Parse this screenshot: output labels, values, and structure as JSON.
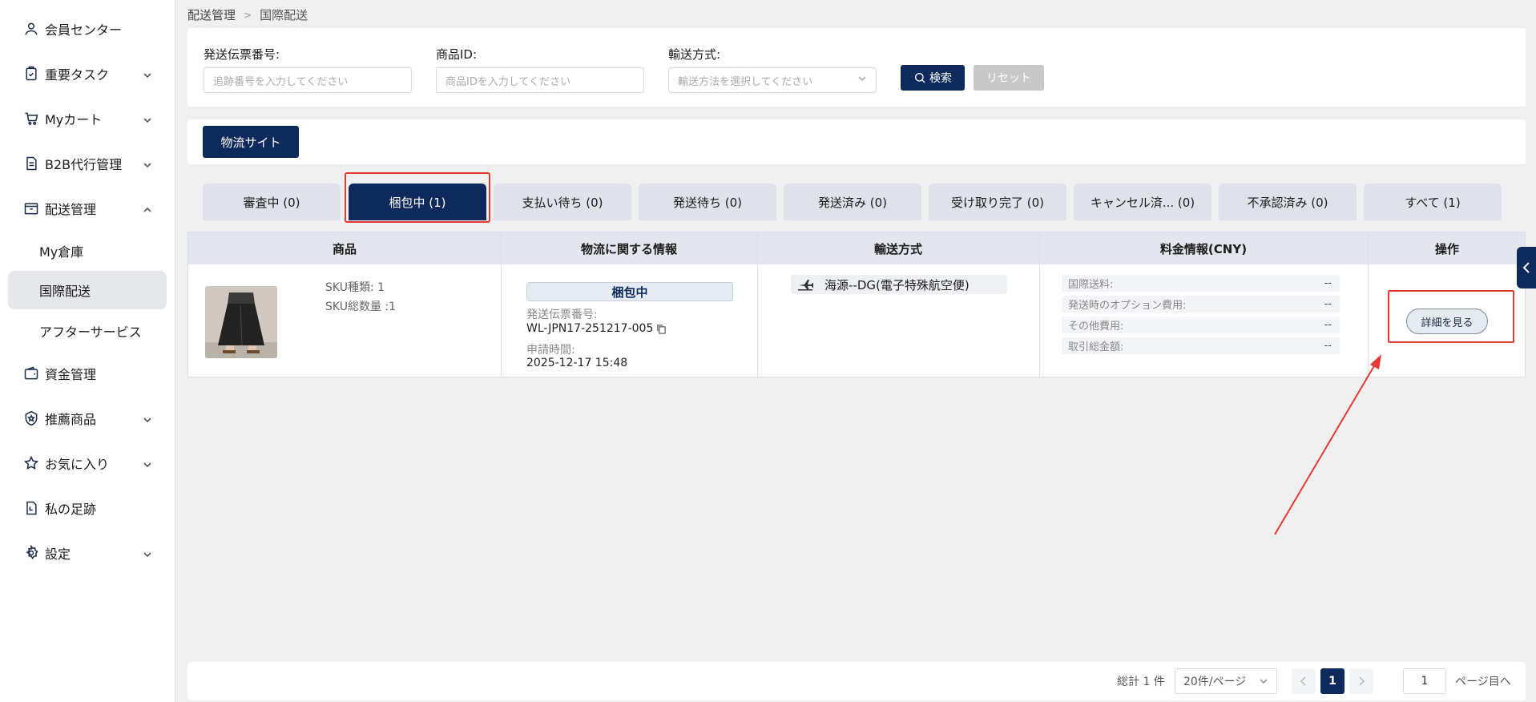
{
  "sidebar": {
    "items": [
      {
        "label": "会員センター",
        "icon": "user-icon",
        "chevron": false
      },
      {
        "label": "重要タスク",
        "icon": "clipboard-check-icon",
        "chevron": true
      },
      {
        "label": "Myカート",
        "icon": "cart-icon",
        "chevron": true
      },
      {
        "label": "B2B代行管理",
        "icon": "document-icon",
        "chevron": true
      },
      {
        "label": "配送管理",
        "icon": "box-icon",
        "chevron": true,
        "expanded": true
      },
      {
        "label": "資金管理",
        "icon": "wallet-icon",
        "chevron": false
      },
      {
        "label": "推薦商品",
        "icon": "badge-star-icon",
        "chevron": true
      },
      {
        "label": "お気に入り",
        "icon": "star-icon",
        "chevron": true
      },
      {
        "label": "私の足跡",
        "icon": "history-icon",
        "chevron": false
      },
      {
        "label": "設定",
        "icon": "gear-icon",
        "chevron": true
      }
    ],
    "sub_items": [
      {
        "label": "My倉庫",
        "active": false
      },
      {
        "label": "国際配送",
        "active": true
      },
      {
        "label": "アフターサービス",
        "active": false
      }
    ]
  },
  "breadcrumb": {
    "parent": "配送管理",
    "current": "国際配送"
  },
  "filters": {
    "tracking": {
      "label": "発送伝票番号:",
      "placeholder": "追跡番号を入力してください"
    },
    "product_id": {
      "label": "商品ID:",
      "placeholder": "商品IDを入力してください"
    },
    "shipping_method": {
      "label": "輸送方式:",
      "placeholder": "輸送方法を選択してください"
    },
    "search_label": "検索",
    "reset_label": "リセット"
  },
  "logistics_button": "物流サイト",
  "tabs": [
    "審査中 (0)",
    "梱包中 (1)",
    "支払い待ち (0)",
    "発送待ち (0)",
    "発送済み (0)",
    "受け取り完了 (0)",
    "キャンセル済... (0)",
    "不承認済み (0)",
    "すべて (1)"
  ],
  "active_tab_index": 1,
  "table": {
    "headers": [
      "商品",
      "物流に関する情報",
      "輸送方式",
      "料金情報(CNY)",
      "操作"
    ],
    "row": {
      "sku_types": "SKU種類: 1",
      "sku_total": "SKU総数量 :1",
      "status": "梱包中",
      "tracking_label": "発送伝票番号:",
      "tracking_value": "WL-JPN17-251217-005",
      "applied_label": "申請時間:",
      "applied_value": "2025-12-17 15:48",
      "transport": "海源--DG(電子特殊航空便)",
      "fees": [
        {
          "label": "国際送料:",
          "value": "--"
        },
        {
          "label": "発送時のオプション費用:",
          "value": "--"
        },
        {
          "label": "その他費用:",
          "value": "--"
        },
        {
          "label": "取引総金額:",
          "value": "--"
        }
      ],
      "detail_button": "詳細を見る"
    }
  },
  "pagination": {
    "total": "総計 1 件",
    "page_size": "20件/ページ",
    "current_page": "1",
    "jump_value": "1",
    "jump_suffix": "ページ目へ"
  },
  "colors": {
    "primary": "#0e2a5c",
    "highlight": "#e53935"
  }
}
